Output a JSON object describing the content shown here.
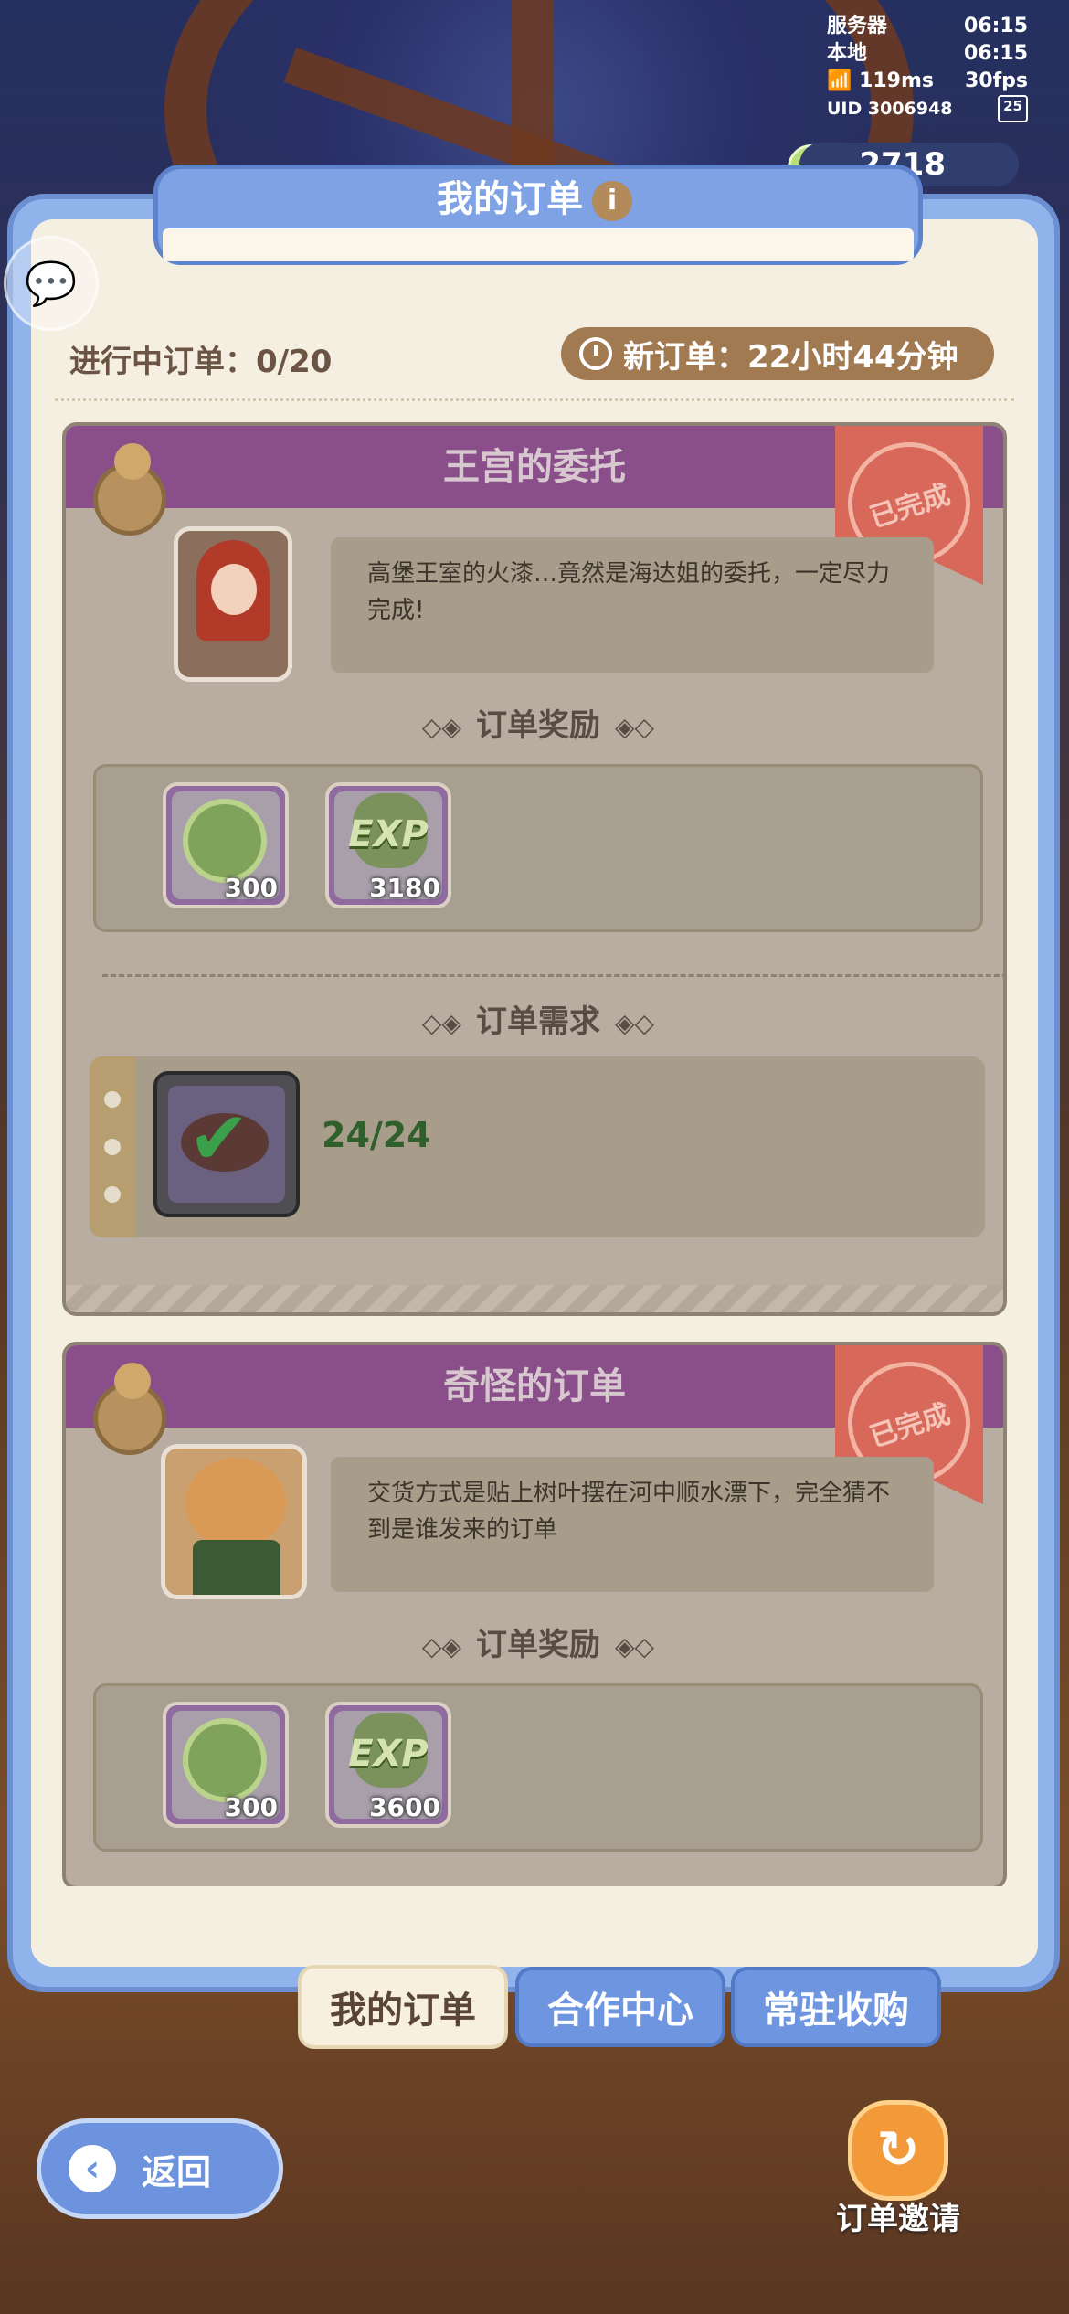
{
  "hud": {
    "server_label": "服务器",
    "server_time": "06:15",
    "local_label": "本地",
    "local_time": "06:15",
    "ping": "119ms",
    "fps": "30fps",
    "uid": "UID 3006948",
    "battery": "25"
  },
  "currency": {
    "amount": "2718",
    "icon": "clover-coin-icon"
  },
  "panel": {
    "title": "我的订单",
    "progress_label": "进行中订单：0/20",
    "timer_label": "新订单：22小时44分钟"
  },
  "orders": [
    {
      "title": "王宫的委托",
      "stamp": "已完成",
      "description": "高堡王室的火漆…竟然是海达姐的委托，一定尽力完成!",
      "reward_heading": "订单奖励",
      "rewards": [
        {
          "icon": "clover-coin-icon",
          "qty": "300"
        },
        {
          "icon": "exp-clover-icon",
          "label": "EXP",
          "qty": "3180"
        }
      ],
      "requirement_heading": "订单需求",
      "requirement": {
        "icon": "steak-icon",
        "progress": "24/24",
        "done": true
      }
    },
    {
      "title": "奇怪的订单",
      "stamp": "已完成",
      "description": "交货方式是贴上树叶摆在河中顺水漂下，完全猜不到是谁发来的订单",
      "reward_heading": "订单奖励",
      "rewards": [
        {
          "icon": "clover-coin-icon",
          "qty": "300"
        },
        {
          "icon": "exp-clover-icon",
          "label": "EXP",
          "qty": "3600"
        }
      ]
    }
  ],
  "tabs": [
    {
      "label": "我的订单",
      "active": true
    },
    {
      "label": "合作中心",
      "active": false
    },
    {
      "label": "常驻收购",
      "active": false
    }
  ],
  "back_label": "返回",
  "invite_label": "订单邀请",
  "colors": {
    "panel_blue": "#8fb3ea",
    "card_header": "#8a4f8a",
    "stamp_red": "#d8685a"
  }
}
